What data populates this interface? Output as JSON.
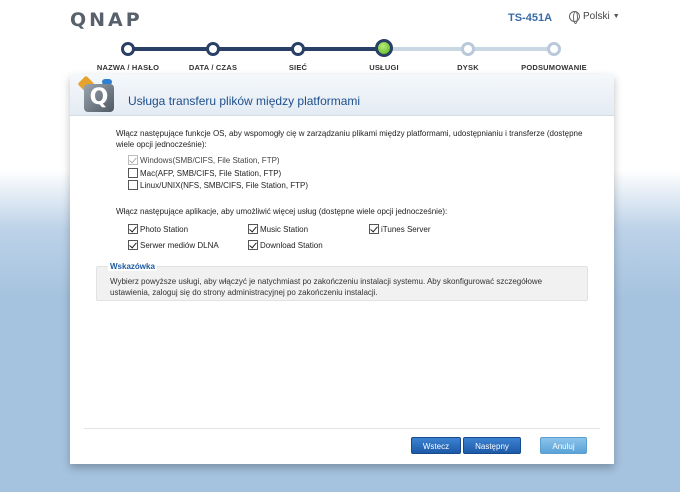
{
  "header": {
    "logo": "QNAP",
    "model": "TS-451A",
    "language": "Polski"
  },
  "steps": [
    {
      "label": "NAZWA / HASŁO",
      "state": "done"
    },
    {
      "label": "DATA / CZAS",
      "state": "done"
    },
    {
      "label": "SIEĆ",
      "state": "done"
    },
    {
      "label": "USŁUGI",
      "state": "current"
    },
    {
      "label": "DYSK",
      "state": "todo"
    },
    {
      "label": "PODSUMOWANIE",
      "state": "todo"
    }
  ],
  "panel": {
    "title": "Usługa transferu plików między platformami",
    "intro": "Włącz następujące funkcje OS, aby wspomogły cię w zarządzaniu plikami między platformami, udostępnianiu i transferze (dostępne wiele opcji jednocześnie):",
    "os_options": [
      {
        "label": "Windows(SMB/CIFS, File Station, FTP)",
        "checked": true,
        "disabled": true
      },
      {
        "label": "Mac(AFP, SMB/CIFS, File Station, FTP)",
        "checked": false,
        "disabled": false
      },
      {
        "label": "Linux/UNIX(NFS, SMB/CIFS, File Station, FTP)",
        "checked": false,
        "disabled": false
      }
    ],
    "apps_intro": "Włącz następujące aplikacje, aby umożliwić więcej usług (dostępne wiele opcji jednocześnie):",
    "apps": [
      {
        "label": "Photo Station",
        "checked": true
      },
      {
        "label": "Music Station",
        "checked": true
      },
      {
        "label": "iTunes Server",
        "checked": true
      },
      {
        "label": "Serwer mediów DLNA",
        "checked": true
      },
      {
        "label": "Download Station",
        "checked": true
      }
    ],
    "tip_title": "Wskazówka",
    "tip_text": "Wybierz powyższe usługi, aby włączyć je natychmiast po zakończeniu instalacji systemu. Aby skonfigurować szczegółowe ustawienia, zaloguj się do strony administracyjnej po zakończeniu instalacji."
  },
  "buttons": {
    "back": "Wstecz",
    "next": "Następny",
    "cancel": "Anuluj"
  }
}
